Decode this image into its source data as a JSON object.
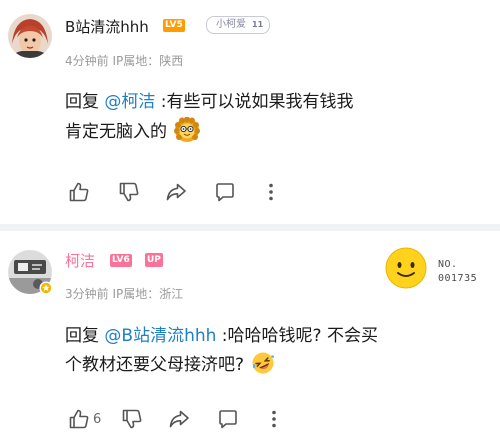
{
  "comments": [
    {
      "username": "B站清流hhh",
      "level_badge": "LV5",
      "fan_medal": {
        "name": "小柯爱",
        "level": "11"
      },
      "meta": "4分钟前  IP属地：陕西",
      "reply_prefix": "回复 ",
      "mention": "@柯洁",
      "text": " :有些可以说如果我有钱我肯定无脑入的",
      "emoji": "lion-emoji",
      "actions": {
        "like_count": ""
      }
    },
    {
      "username": "柯洁",
      "level_badge": "LV6",
      "up_badge": "UP",
      "meta": "3分钟前  IP属地：浙江",
      "reply_prefix": "回复 ",
      "mention": "@B站清流hhh",
      "text": " :哈哈哈钱呢? 不会买个教材还要父母接济吧?",
      "emoji": "rofl-emoji",
      "decoration": {
        "label_line1": "NO.",
        "label_line2": "001735"
      },
      "actions": {
        "like_count": "6"
      }
    }
  ],
  "colors": {
    "username": "#1b1b1b",
    "up_username": "#fb7299",
    "lv5": "#ff9c00",
    "lv6": "#fb7299",
    "mention": "#1f80c6",
    "meta": "#9a9a9a"
  }
}
